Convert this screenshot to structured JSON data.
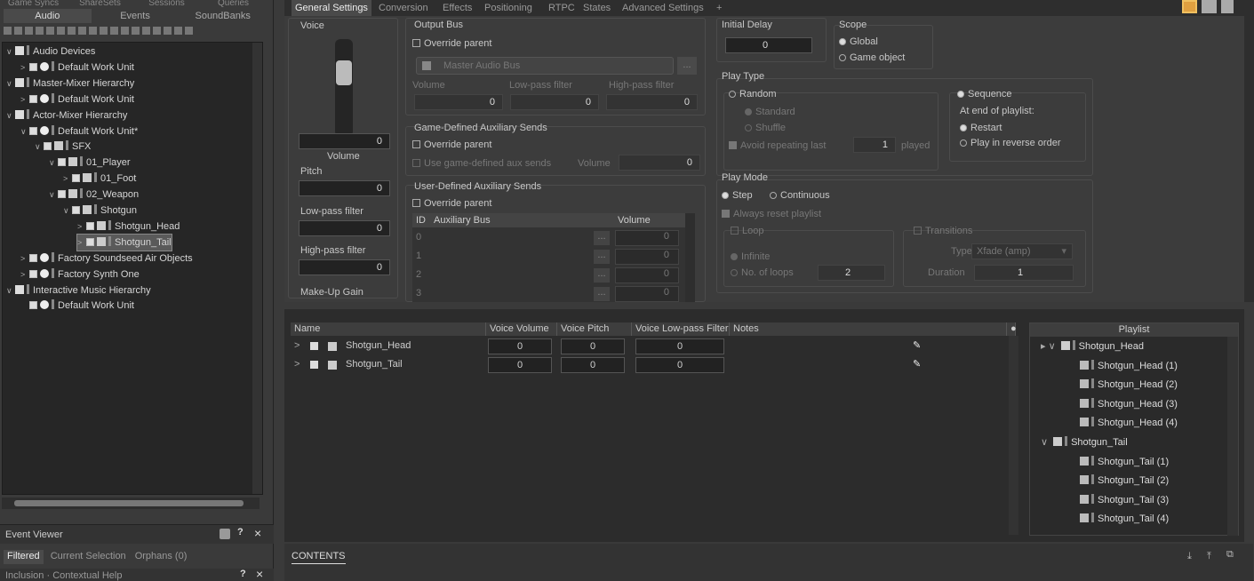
{
  "left": {
    "top_tabs": [
      "Game Syncs",
      "ShareSets",
      "Sessions",
      "Queries"
    ],
    "tabs": [
      "Audio",
      "Events",
      "SoundBanks"
    ],
    "tree": [
      {
        "label": "Audio Devices",
        "depth": 0,
        "kind": "folder",
        "exp": "∨"
      },
      {
        "label": "Default Work Unit",
        "depth": 1,
        "kind": "wu",
        "exp": ">"
      },
      {
        "label": "Master-Mixer Hierarchy",
        "depth": 0,
        "kind": "folder",
        "exp": "∨"
      },
      {
        "label": "Default Work Unit",
        "depth": 1,
        "kind": "wu",
        "exp": ">"
      },
      {
        "label": "Actor-Mixer Hierarchy",
        "depth": 0,
        "kind": "folder",
        "exp": "∨"
      },
      {
        "label": "Default Work Unit*",
        "depth": 1,
        "kind": "wu",
        "exp": "∨"
      },
      {
        "label": "SFX",
        "depth": 2,
        "kind": "mixer",
        "exp": "∨"
      },
      {
        "label": "01_Player",
        "depth": 3,
        "kind": "mixer",
        "exp": "∨"
      },
      {
        "label": "01_Foot",
        "depth": 4,
        "kind": "switch",
        "exp": ">"
      },
      {
        "label": "02_Weapon",
        "depth": 3,
        "kind": "mixer",
        "exp": "∨"
      },
      {
        "label": "Shotgun",
        "depth": 4,
        "kind": "seq",
        "exp": "∨"
      },
      {
        "label": "Shotgun_Head",
        "depth": 5,
        "kind": "rand",
        "exp": ">"
      },
      {
        "label": "Shotgun_Tail",
        "depth": 5,
        "kind": "rand",
        "exp": ">"
      },
      {
        "label": "Factory Soundseed Air Objects",
        "depth": 1,
        "kind": "wu",
        "exp": ">"
      },
      {
        "label": "Factory Synth One",
        "depth": 1,
        "kind": "wu",
        "exp": ">"
      },
      {
        "label": "Interactive Music Hierarchy",
        "depth": 0,
        "kind": "folder",
        "exp": "∨"
      },
      {
        "label": "Default Work Unit",
        "depth": 1,
        "kind": "wu",
        "exp": ""
      }
    ],
    "event_viewer": "Event Viewer",
    "ev_tabs": [
      "Filtered",
      "Current Selection",
      "Orphans (0)"
    ],
    "help": "Inclusion · Contextual Help"
  },
  "main": {
    "tabs": [
      "General Settings",
      "Conversion",
      "Effects",
      "Positioning",
      "RTPC",
      "States",
      "Advanced Settings",
      "+"
    ],
    "voice": {
      "title": "Voice",
      "volume_label": "Volume",
      "volume": "0",
      "pitch_label": "Pitch",
      "pitch": "0",
      "lpf_label": "Low-pass filter",
      "lpf": "0",
      "hpf_label": "High-pass filter",
      "hpf": "0",
      "makeup": "Make-Up Gain"
    },
    "output_bus": {
      "title": "Output Bus",
      "override": "Override parent",
      "bus": "Master Audio Bus",
      "btn": "...",
      "cols": [
        "Volume",
        "Low-pass filter",
        "High-pass filter"
      ],
      "vals": [
        "0",
        "0",
        "0"
      ]
    },
    "gda": {
      "title": "Game-Defined Auxiliary Sends",
      "override": "Override parent",
      "use": "Use game-defined aux sends",
      "vol_label": "Volume",
      "vol": "0"
    },
    "uda": {
      "title": "User-Defined Auxiliary Sends",
      "override": "Override parent",
      "cols": [
        "ID",
        "Auxiliary Bus",
        "Volume"
      ],
      "rows": [
        "0",
        "1",
        "2",
        "3"
      ],
      "vol": "0",
      "btn": "..."
    },
    "initial_delay": {
      "title": "Initial Delay",
      "value": "0"
    },
    "scope": {
      "title": "Scope",
      "options": [
        "Global",
        "Game object"
      ]
    },
    "play_type": {
      "title": "Play Type",
      "random": "Random",
      "standard": "Standard",
      "shuffle": "Shuffle",
      "avoid": "Avoid repeating last",
      "avoid_n": "1",
      "played": "played",
      "sequence": "Sequence",
      "end": "At end of playlist:",
      "restart": "Restart",
      "reverse": "Play in reverse order"
    },
    "play_mode": {
      "title": "Play Mode",
      "step": "Step",
      "continuous": "Continuous",
      "always_reset": "Always reset playlist",
      "loop": "Loop",
      "infinite": "Infinite",
      "no_loops": "No. of loops",
      "loops_n": "2",
      "transitions": "Transitions",
      "type_label": "Type",
      "type": "Xfade (amp)",
      "duration_label": "Duration",
      "duration": "1"
    }
  },
  "contents": {
    "cols": [
      "Name",
      "Voice Volume",
      "Voice Pitch",
      "Voice Low-pass Filter",
      "Notes"
    ],
    "rows": [
      {
        "name": "Shotgun_Head",
        "vol": "0",
        "pitch": "0",
        "lpf": "0"
      },
      {
        "name": "Shotgun_Tail",
        "vol": "0",
        "pitch": "0",
        "lpf": "0"
      }
    ],
    "playlist_title": "Playlist",
    "playlist": [
      {
        "label": "Shotgun_Head",
        "group": true
      },
      {
        "label": "Shotgun_Head (1)"
      },
      {
        "label": "Shotgun_Head (2)"
      },
      {
        "label": "Shotgun_Head (3)"
      },
      {
        "label": "Shotgun_Head (4)"
      },
      {
        "label": "Shotgun_Tail",
        "group": true
      },
      {
        "label": "Shotgun_Tail (1)"
      },
      {
        "label": "Shotgun_Tail (2)"
      },
      {
        "label": "Shotgun_Tail (3)"
      },
      {
        "label": "Shotgun_Tail (4)"
      }
    ],
    "footer_tab": "CONTENTS"
  }
}
